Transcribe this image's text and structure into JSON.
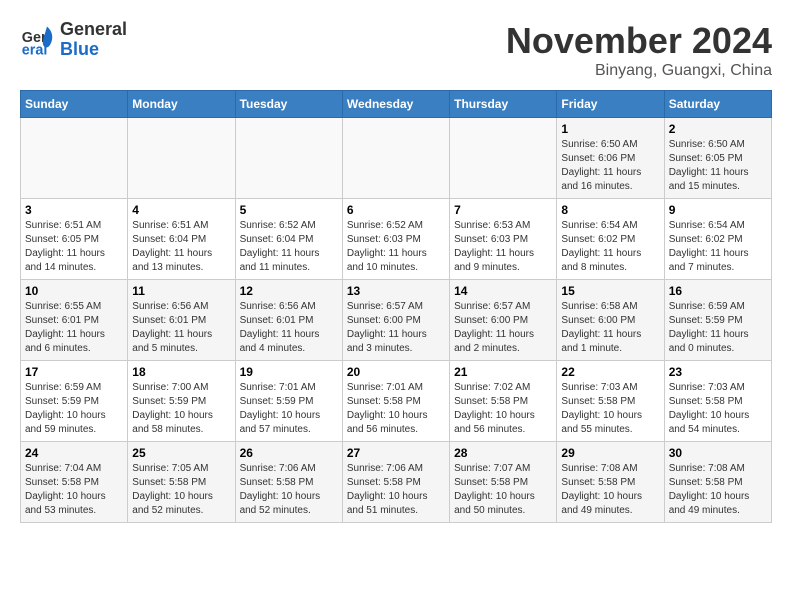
{
  "header": {
    "logo_general": "General",
    "logo_blue": "Blue",
    "month_title": "November 2024",
    "location": "Binyang, Guangxi, China"
  },
  "weekdays": [
    "Sunday",
    "Monday",
    "Tuesday",
    "Wednesday",
    "Thursday",
    "Friday",
    "Saturday"
  ],
  "weeks": [
    [
      {
        "day": "",
        "info": ""
      },
      {
        "day": "",
        "info": ""
      },
      {
        "day": "",
        "info": ""
      },
      {
        "day": "",
        "info": ""
      },
      {
        "day": "",
        "info": ""
      },
      {
        "day": "1",
        "info": "Sunrise: 6:50 AM\nSunset: 6:06 PM\nDaylight: 11 hours and 16 minutes."
      },
      {
        "day": "2",
        "info": "Sunrise: 6:50 AM\nSunset: 6:05 PM\nDaylight: 11 hours and 15 minutes."
      }
    ],
    [
      {
        "day": "3",
        "info": "Sunrise: 6:51 AM\nSunset: 6:05 PM\nDaylight: 11 hours and 14 minutes."
      },
      {
        "day": "4",
        "info": "Sunrise: 6:51 AM\nSunset: 6:04 PM\nDaylight: 11 hours and 13 minutes."
      },
      {
        "day": "5",
        "info": "Sunrise: 6:52 AM\nSunset: 6:04 PM\nDaylight: 11 hours and 11 minutes."
      },
      {
        "day": "6",
        "info": "Sunrise: 6:52 AM\nSunset: 6:03 PM\nDaylight: 11 hours and 10 minutes."
      },
      {
        "day": "7",
        "info": "Sunrise: 6:53 AM\nSunset: 6:03 PM\nDaylight: 11 hours and 9 minutes."
      },
      {
        "day": "8",
        "info": "Sunrise: 6:54 AM\nSunset: 6:02 PM\nDaylight: 11 hours and 8 minutes."
      },
      {
        "day": "9",
        "info": "Sunrise: 6:54 AM\nSunset: 6:02 PM\nDaylight: 11 hours and 7 minutes."
      }
    ],
    [
      {
        "day": "10",
        "info": "Sunrise: 6:55 AM\nSunset: 6:01 PM\nDaylight: 11 hours and 6 minutes."
      },
      {
        "day": "11",
        "info": "Sunrise: 6:56 AM\nSunset: 6:01 PM\nDaylight: 11 hours and 5 minutes."
      },
      {
        "day": "12",
        "info": "Sunrise: 6:56 AM\nSunset: 6:01 PM\nDaylight: 11 hours and 4 minutes."
      },
      {
        "day": "13",
        "info": "Sunrise: 6:57 AM\nSunset: 6:00 PM\nDaylight: 11 hours and 3 minutes."
      },
      {
        "day": "14",
        "info": "Sunrise: 6:57 AM\nSunset: 6:00 PM\nDaylight: 11 hours and 2 minutes."
      },
      {
        "day": "15",
        "info": "Sunrise: 6:58 AM\nSunset: 6:00 PM\nDaylight: 11 hours and 1 minute."
      },
      {
        "day": "16",
        "info": "Sunrise: 6:59 AM\nSunset: 5:59 PM\nDaylight: 11 hours and 0 minutes."
      }
    ],
    [
      {
        "day": "17",
        "info": "Sunrise: 6:59 AM\nSunset: 5:59 PM\nDaylight: 10 hours and 59 minutes."
      },
      {
        "day": "18",
        "info": "Sunrise: 7:00 AM\nSunset: 5:59 PM\nDaylight: 10 hours and 58 minutes."
      },
      {
        "day": "19",
        "info": "Sunrise: 7:01 AM\nSunset: 5:59 PM\nDaylight: 10 hours and 57 minutes."
      },
      {
        "day": "20",
        "info": "Sunrise: 7:01 AM\nSunset: 5:58 PM\nDaylight: 10 hours and 56 minutes."
      },
      {
        "day": "21",
        "info": "Sunrise: 7:02 AM\nSunset: 5:58 PM\nDaylight: 10 hours and 56 minutes."
      },
      {
        "day": "22",
        "info": "Sunrise: 7:03 AM\nSunset: 5:58 PM\nDaylight: 10 hours and 55 minutes."
      },
      {
        "day": "23",
        "info": "Sunrise: 7:03 AM\nSunset: 5:58 PM\nDaylight: 10 hours and 54 minutes."
      }
    ],
    [
      {
        "day": "24",
        "info": "Sunrise: 7:04 AM\nSunset: 5:58 PM\nDaylight: 10 hours and 53 minutes."
      },
      {
        "day": "25",
        "info": "Sunrise: 7:05 AM\nSunset: 5:58 PM\nDaylight: 10 hours and 52 minutes."
      },
      {
        "day": "26",
        "info": "Sunrise: 7:06 AM\nSunset: 5:58 PM\nDaylight: 10 hours and 52 minutes."
      },
      {
        "day": "27",
        "info": "Sunrise: 7:06 AM\nSunset: 5:58 PM\nDaylight: 10 hours and 51 minutes."
      },
      {
        "day": "28",
        "info": "Sunrise: 7:07 AM\nSunset: 5:58 PM\nDaylight: 10 hours and 50 minutes."
      },
      {
        "day": "29",
        "info": "Sunrise: 7:08 AM\nSunset: 5:58 PM\nDaylight: 10 hours and 49 minutes."
      },
      {
        "day": "30",
        "info": "Sunrise: 7:08 AM\nSunset: 5:58 PM\nDaylight: 10 hours and 49 minutes."
      }
    ]
  ]
}
